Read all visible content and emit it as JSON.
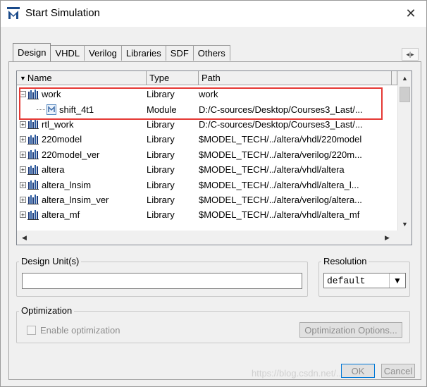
{
  "window": {
    "title": "Start Simulation",
    "close_glyph": "✕",
    "icon": "modelsim-m-icon"
  },
  "tabs": [
    {
      "label": "Design",
      "active": true
    },
    {
      "label": "VHDL",
      "active": false
    },
    {
      "label": "Verilog",
      "active": false
    },
    {
      "label": "Libraries",
      "active": false
    },
    {
      "label": "SDF",
      "active": false
    },
    {
      "label": "Others",
      "active": false
    }
  ],
  "tab_scroll_glyph": "◂|▸",
  "library_list": {
    "columns": [
      "Name",
      "Type",
      "Path"
    ],
    "rows": [
      {
        "name": "work",
        "type": "Library",
        "path": "work",
        "kind": "library",
        "expanded": true
      },
      {
        "name": "shift_4t1",
        "type": "Module",
        "path": "D:/C-sources/Desktop/Courses3_Last/...",
        "kind": "module"
      },
      {
        "name": "rtl_work",
        "type": "Library",
        "path": "D:/C-sources/Desktop/Courses3_Last/...",
        "kind": "library"
      },
      {
        "name": "220model",
        "type": "Library",
        "path": "$MODEL_TECH/../altera/vhdl/220model",
        "kind": "library"
      },
      {
        "name": "220model_ver",
        "type": "Library",
        "path": "$MODEL_TECH/../altera/verilog/220m...",
        "kind": "library"
      },
      {
        "name": "altera",
        "type": "Library",
        "path": "$MODEL_TECH/../altera/vhdl/altera",
        "kind": "library"
      },
      {
        "name": "altera_lnsim",
        "type": "Library",
        "path": "$MODEL_TECH/../altera/vhdl/altera_l...",
        "kind": "library"
      },
      {
        "name": "altera_lnsim_ver",
        "type": "Library",
        "path": "$MODEL_TECH/../altera/verilog/altera...",
        "kind": "library"
      },
      {
        "name": "altera_mf",
        "type": "Library",
        "path": "$MODEL_TECH/../altera/vhdl/altera_mf",
        "kind": "library"
      }
    ],
    "highlight_color": "#e53935"
  },
  "design_units": {
    "label": "Design Unit(s)",
    "value": ""
  },
  "resolution": {
    "label": "Resolution",
    "value": "default"
  },
  "optimization": {
    "label": "Optimization",
    "enable_label": "Enable optimization",
    "enabled": false,
    "options_button": "Optimization Options..."
  },
  "buttons": {
    "ok": "OK",
    "cancel": "Cancel"
  },
  "watermark": "https://blog.csdn.net/..."
}
